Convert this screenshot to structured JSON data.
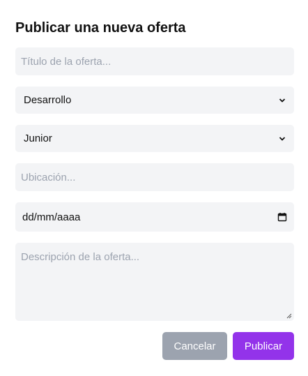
{
  "form": {
    "title": "Publicar una nueva oferta",
    "offer_title": {
      "value": "",
      "placeholder": "Título de la oferta..."
    },
    "category": {
      "selected": "Desarrollo"
    },
    "level": {
      "selected": "Junior"
    },
    "location": {
      "value": "",
      "placeholder": "Ubicación..."
    },
    "date": {
      "display": "dd/mm/aaaa"
    },
    "description": {
      "value": "",
      "placeholder": "Descripción de la oferta..."
    },
    "cancel_label": "Cancelar",
    "publish_label": "Publicar"
  },
  "icons": {
    "select_chevron": "chevron-down-icon",
    "date_picker": "calendar-icon"
  },
  "colors": {
    "field_bg": "#f3f4f6",
    "cancel_bg": "#9ca3af",
    "publish_bg": "#9333ea"
  }
}
